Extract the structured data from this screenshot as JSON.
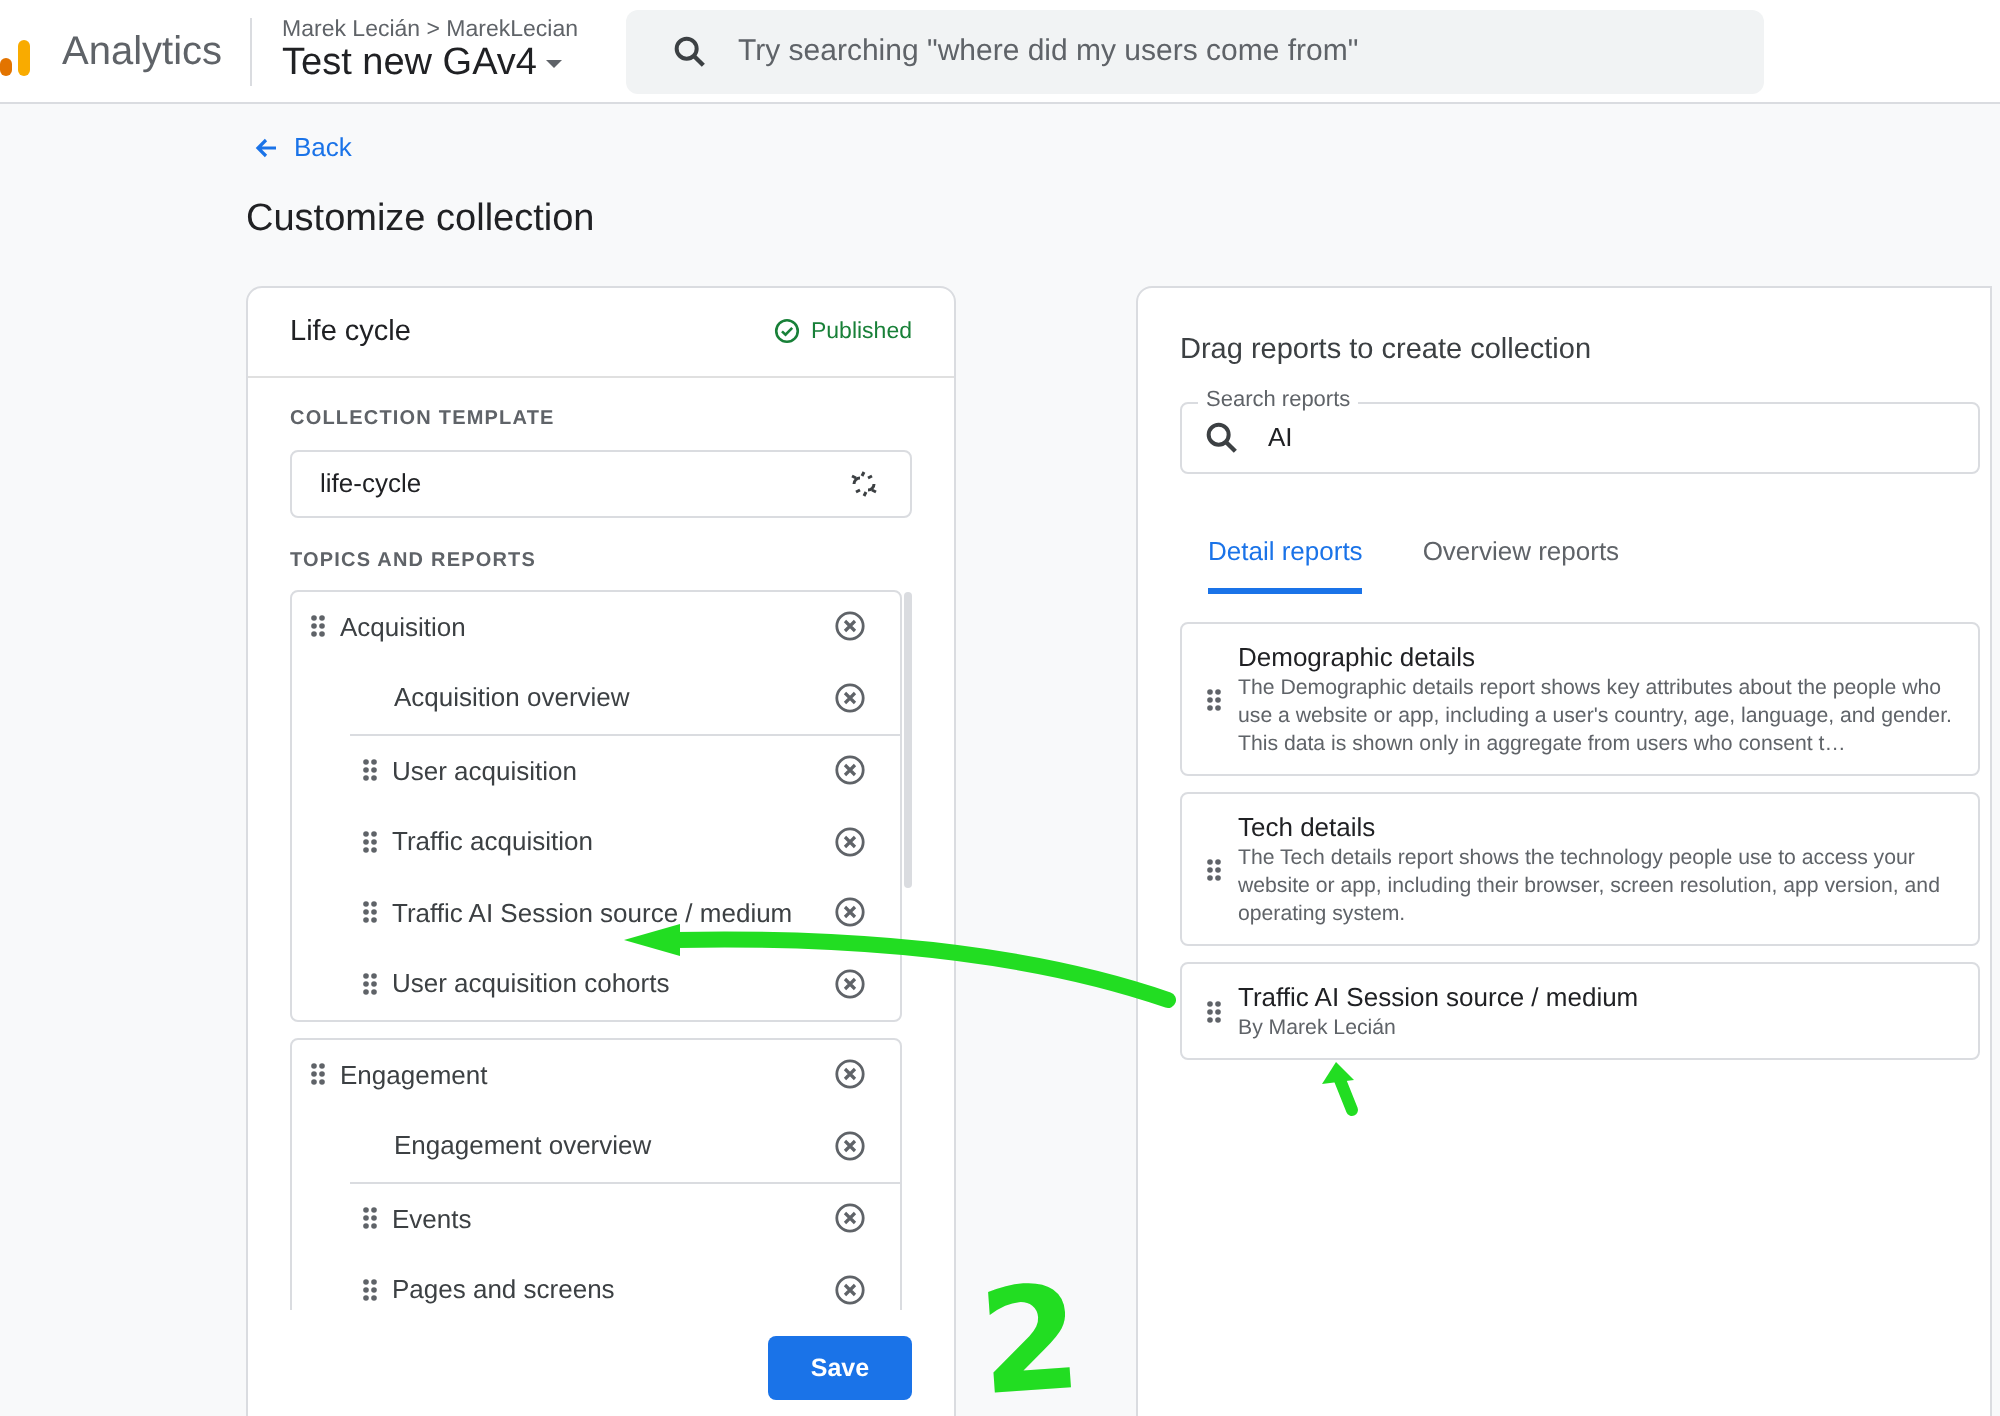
{
  "header": {
    "product": "Analytics",
    "breadcrumb": "Marek Lecián > MarekLecian",
    "property": "Test new GAv4",
    "search_placeholder": "Try searching \"where did my users come from\""
  },
  "page": {
    "back": "Back",
    "title": "Customize collection"
  },
  "collection": {
    "name": "Life cycle",
    "status": "Published",
    "template_label": "COLLECTION TEMPLATE",
    "template_value": "life-cycle",
    "topics_label": "TOPICS AND REPORTS",
    "topics": [
      {
        "label": "Acquisition",
        "children": [
          {
            "label": "Acquisition overview",
            "kind": "overview"
          },
          {
            "label": "User acquisition",
            "kind": "report"
          },
          {
            "label": "Traffic acquisition",
            "kind": "report"
          },
          {
            "label": "Traffic AI Session source / medium",
            "kind": "report"
          },
          {
            "label": "User acquisition cohorts",
            "kind": "report"
          }
        ]
      },
      {
        "label": "Engagement",
        "children": [
          {
            "label": "Engagement overview",
            "kind": "overview"
          },
          {
            "label": "Events",
            "kind": "report"
          },
          {
            "label": "Pages and screens",
            "kind": "report"
          }
        ]
      }
    ],
    "save": "Save"
  },
  "library": {
    "title": "Drag reports to create collection",
    "search_label": "Search reports",
    "search_value": "AI",
    "tabs": [
      {
        "label": "Detail reports",
        "selected": true
      },
      {
        "label": "Overview reports",
        "selected": false
      }
    ],
    "reports": [
      {
        "title": "Demographic details",
        "subtitle": "The Demographic details report shows key attributes about the people who use a website or app, including a user's country, age, language, and gender. This data is shown only in aggregate from users who consent t…"
      },
      {
        "title": "Tech details",
        "subtitle": "The Tech details report shows the technology people use to access your website or app, including their browser, screen resolution, app version, and operating system."
      },
      {
        "title": "Traffic AI Session source / medium",
        "subtitle": "By Marek Lecián"
      }
    ]
  },
  "annotation_mark": "2"
}
